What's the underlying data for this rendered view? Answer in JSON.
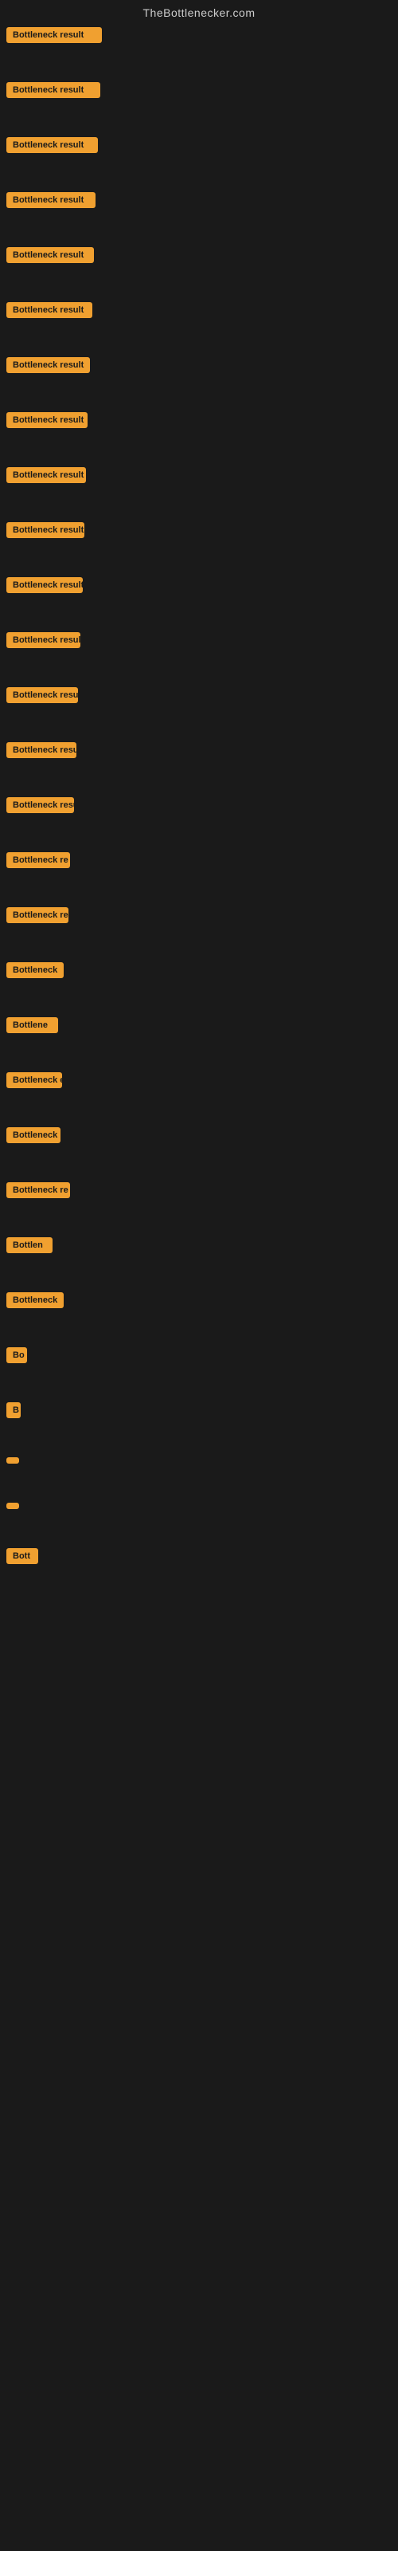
{
  "site": {
    "title": "TheBottlenecker.com"
  },
  "rows": [
    {
      "id": 1,
      "label": "Bottleneck result"
    },
    {
      "id": 2,
      "label": "Bottleneck result"
    },
    {
      "id": 3,
      "label": "Bottleneck result"
    },
    {
      "id": 4,
      "label": "Bottleneck result"
    },
    {
      "id": 5,
      "label": "Bottleneck result"
    },
    {
      "id": 6,
      "label": "Bottleneck result"
    },
    {
      "id": 7,
      "label": "Bottleneck result"
    },
    {
      "id": 8,
      "label": "Bottleneck result"
    },
    {
      "id": 9,
      "label": "Bottleneck result"
    },
    {
      "id": 10,
      "label": "Bottleneck result"
    },
    {
      "id": 11,
      "label": "Bottleneck result"
    },
    {
      "id": 12,
      "label": "Bottleneck result"
    },
    {
      "id": 13,
      "label": "Bottleneck result"
    },
    {
      "id": 14,
      "label": "Bottleneck result"
    },
    {
      "id": 15,
      "label": "Bottleneck result"
    },
    {
      "id": 16,
      "label": "Bottleneck re"
    },
    {
      "id": 17,
      "label": "Bottleneck resul"
    },
    {
      "id": 18,
      "label": "Bottleneck"
    },
    {
      "id": 19,
      "label": "Bottlene"
    },
    {
      "id": 20,
      "label": "Bottleneck e"
    },
    {
      "id": 21,
      "label": "Bottleneck"
    },
    {
      "id": 22,
      "label": "Bottleneck re"
    },
    {
      "id": 23,
      "label": "Bottlen"
    },
    {
      "id": 24,
      "label": "Bottleneck"
    },
    {
      "id": 25,
      "label": "Bo"
    },
    {
      "id": 26,
      "label": "B"
    },
    {
      "id": 27,
      "label": ""
    },
    {
      "id": 28,
      "label": ""
    },
    {
      "id": 29,
      "label": "Bott"
    }
  ]
}
